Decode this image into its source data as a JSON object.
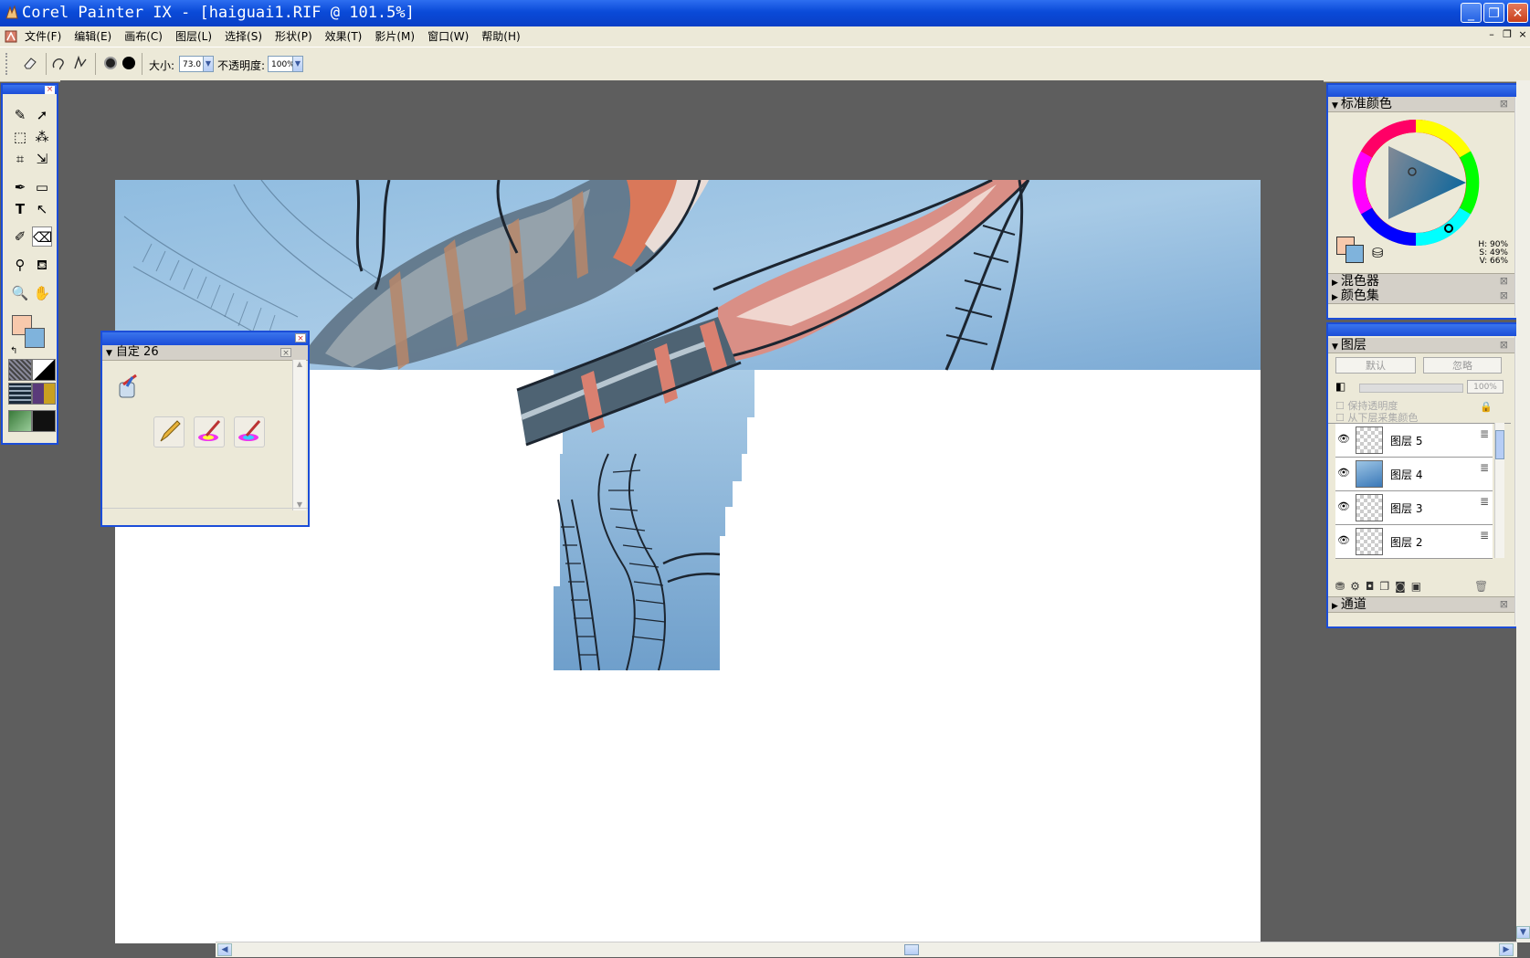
{
  "window": {
    "title": "Corel Painter IX - [haiguai1.RIF @ 101.5%]",
    "minimize": "_",
    "maximize": "❐",
    "close": "✕"
  },
  "menu": {
    "items": [
      "文件(F)",
      "编辑(E)",
      "画布(C)",
      "图层(L)",
      "选择(S)",
      "形状(P)",
      "效果(T)",
      "影片(M)",
      "窗口(W)",
      "帮助(H)"
    ],
    "mdi_minimize": "–",
    "mdi_restore": "❐",
    "mdi_close": "×"
  },
  "propbar": {
    "size_label": "大小:",
    "size_value": "73.0",
    "opacity_label": "不透明度:",
    "opacity_value": "100%"
  },
  "custom_palette": {
    "title": "自定 26"
  },
  "color_panel": {
    "title": "标准颜色",
    "hue": "H: 90%",
    "saturation": "S: 49%",
    "value": "V: 66%",
    "mixer": "混色器",
    "color_sets": "颜色集"
  },
  "layers_panel": {
    "title": "图层",
    "composite_method": "默认",
    "depth": "忽略",
    "opacity": "100%",
    "preserve_transparency": "保持透明度",
    "pick_up_underlying": "从下层采集颜色",
    "layers": [
      {
        "name": "图层 5"
      },
      {
        "name": "图层 4"
      },
      {
        "name": "图层 3"
      },
      {
        "name": "图层 2"
      }
    ],
    "channels": "通道"
  },
  "colors": {
    "xp_blue": "#1b4dd8",
    "sky": "#8ab9dc",
    "primary_color": "#f7c9ac",
    "secondary_color": "#7fb3dc"
  }
}
